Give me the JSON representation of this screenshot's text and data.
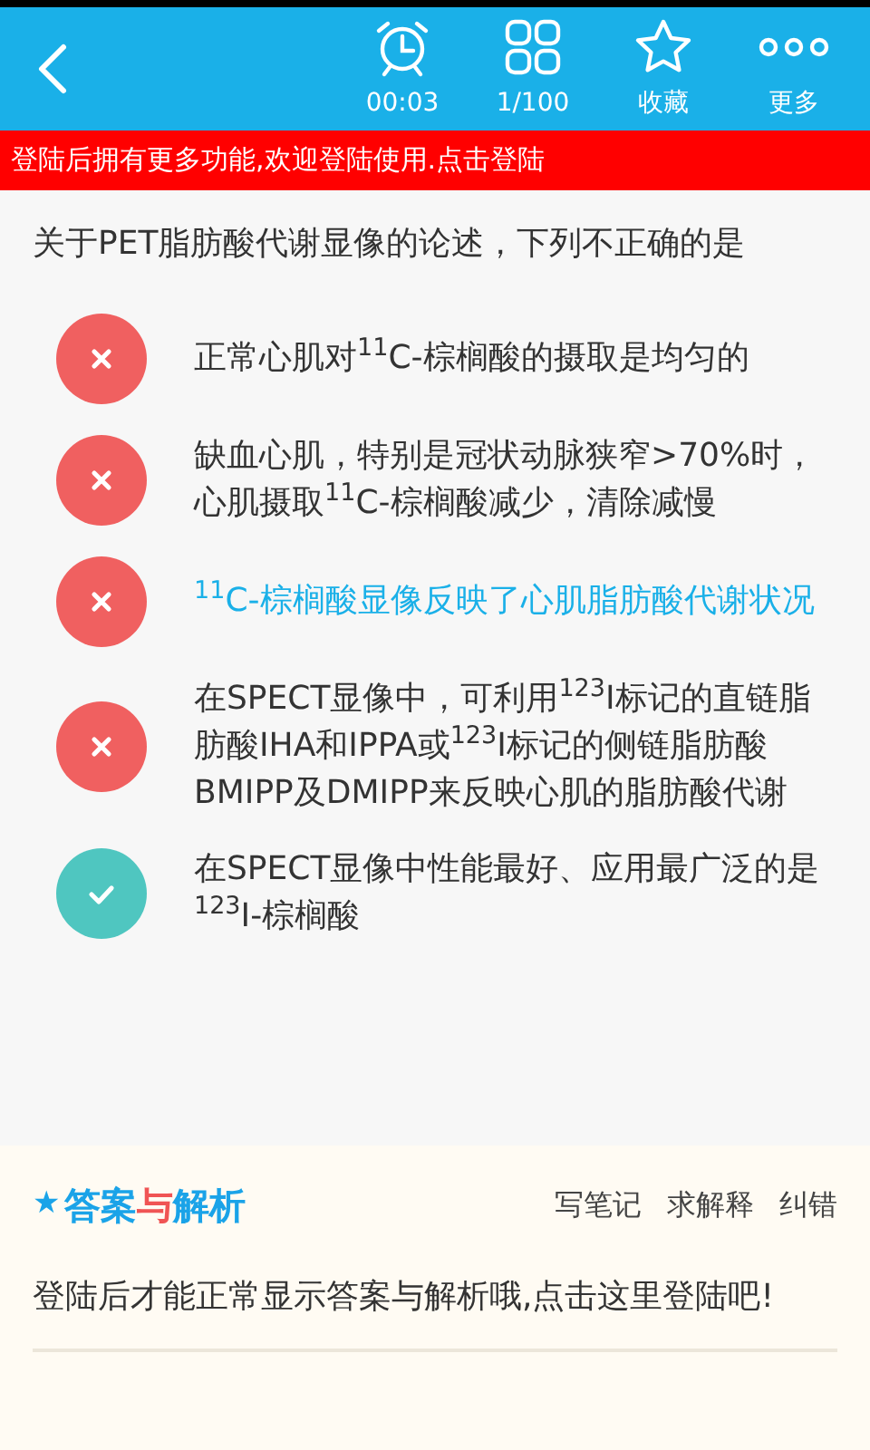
{
  "toolbar": {
    "actions": [
      {
        "kind": "clock",
        "label": "00:03"
      },
      {
        "kind": "grid",
        "label": "1/100"
      },
      {
        "kind": "star",
        "label": "收藏"
      },
      {
        "kind": "more",
        "label": "更多"
      }
    ]
  },
  "login_banner": "登陆后拥有更多功能,欢迎登陆使用.点击登陆",
  "question": "关于PET脂肪酸代谢显像的论述，下列不正确的是",
  "options": [
    {
      "text": "正常心肌对$^{11}$C-棕榈酸的摄取是均匀的",
      "kind": "wrong",
      "selected": false
    },
    {
      "text": "缺血心肌，特别是冠状动脉狭窄>70%时，心肌摄取$^{11}$C-棕榈酸减少，清除减慢",
      "kind": "wrong",
      "selected": false
    },
    {
      "text": "$^{11}$C-棕榈酸显像反映了心肌脂肪酸代谢状况",
      "kind": "wrong",
      "selected": true
    },
    {
      "text": "在SPECT显像中，可利用$^{123}$I标记的直链脂肪酸IHA和IPPA或$^{123}$I标记的侧链脂肪酸BMIPP及DMIPP来反映心肌的脂肪酸代谢",
      "kind": "wrong",
      "selected": false
    },
    {
      "text": "在SPECT显像中性能最好、应用最广泛的是$^{123}$I-棕榈酸",
      "kind": "correct",
      "selected": false
    }
  ],
  "answer_section": {
    "star": "★",
    "title_parts": [
      {
        "text": "答案",
        "color": "#1aa3e8"
      },
      {
        "text": "与",
        "color": "#f05454"
      },
      {
        "text": "解析",
        "color": "#1aa3e8"
      }
    ],
    "links": [
      "写笔记",
      "求解释",
      "纠错"
    ],
    "message": "登陆后才能正常显示答案与解析哦,点击这里登陆吧!"
  }
}
